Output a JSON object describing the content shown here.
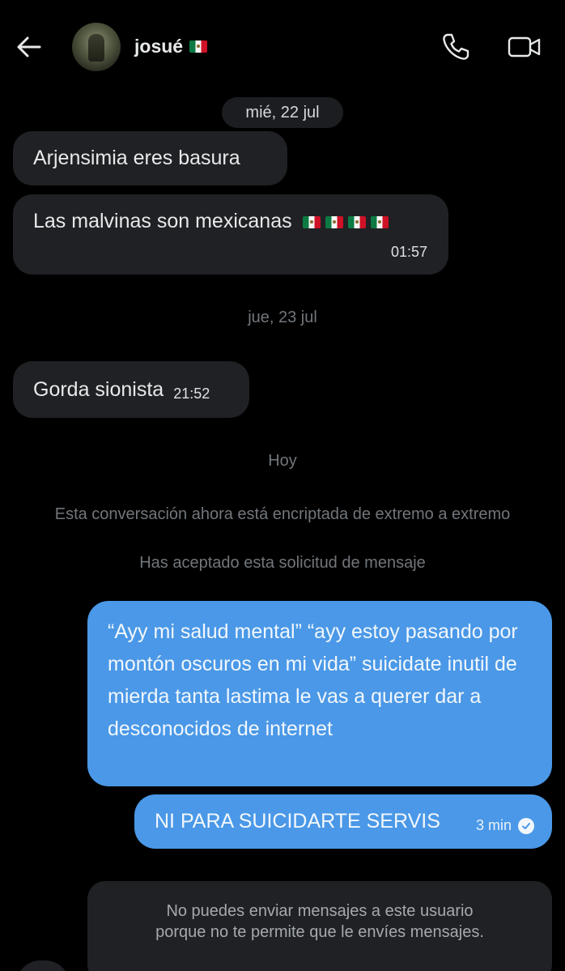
{
  "header": {
    "username": "josué",
    "flag_icon": "mexico-flag-icon",
    "back_icon": "arrow-left-icon",
    "call_icon": "phone-icon",
    "video_icon": "video-camera-icon"
  },
  "messages": {
    "date1": "mié, 22 jul",
    "msg1": "Arjensimia eres basura",
    "msg2": "Las malvinas son mexicanas",
    "msg2_time": "01:57",
    "date2": "jue, 23 jul",
    "msg3": "Gorda sionista",
    "msg3_time": "21:52",
    "date3": "Hoy",
    "system1": "Esta conversación ahora está encriptada de extremo a extremo",
    "system2": "Has aceptado esta solicitud de mensaje",
    "out1": "“Ayy mi salud mental” “ayy estoy pasando por montón oscuros en mi vida” suicidate inutil de mierda tanta lastima le vas a querer dar a desconocidos de internet",
    "out2": "NI PARA SUICIDARTE SERVIS",
    "out2_time": "3 min"
  },
  "notice": {
    "line1": "No puedes enviar mensajes a este usuario",
    "line2": "porque no te permite que le envíes mensajes."
  },
  "colors": {
    "background": "#000000",
    "incoming_bubble": "#1f2124",
    "outgoing_bubble": "#4a98e7"
  }
}
